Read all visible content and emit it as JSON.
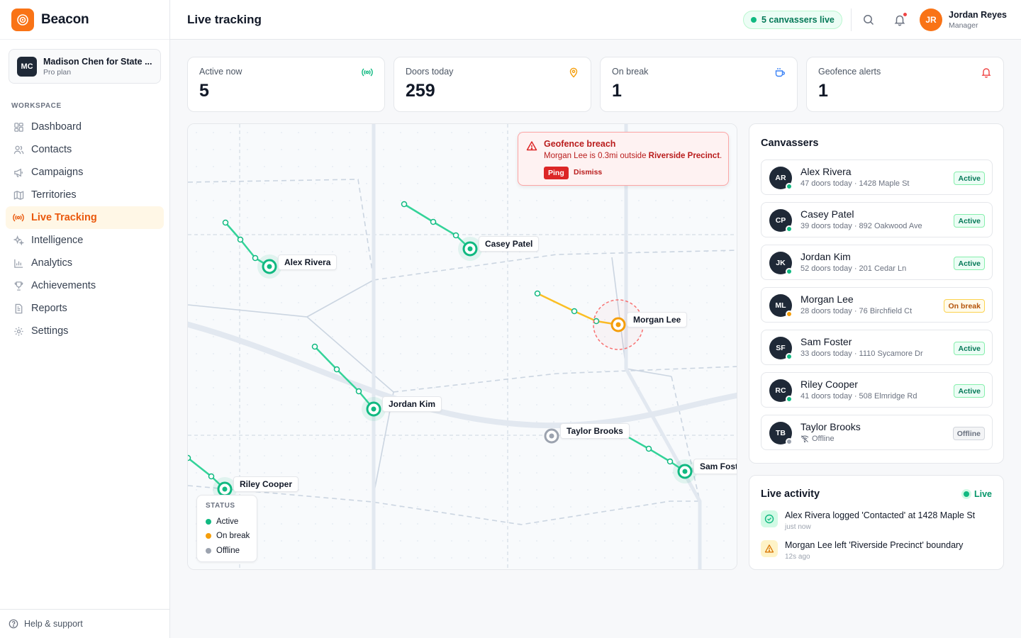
{
  "brand": {
    "name": "Beacon"
  },
  "org": {
    "initials": "MC",
    "name": "Madison Chen for State ...",
    "plan": "Pro plan"
  },
  "sidebar": {
    "section_label": "WORKSPACE",
    "items": [
      {
        "label": "Dashboard",
        "icon": "grid-icon"
      },
      {
        "label": "Contacts",
        "icon": "users-icon"
      },
      {
        "label": "Campaigns",
        "icon": "megaphone-icon"
      },
      {
        "label": "Territories",
        "icon": "map-icon"
      },
      {
        "label": "Live Tracking",
        "icon": "broadcast-icon",
        "active": true
      },
      {
        "label": "Intelligence",
        "icon": "sparkles-icon"
      },
      {
        "label": "Analytics",
        "icon": "bar-chart-icon"
      },
      {
        "label": "Achievements",
        "icon": "trophy-icon"
      },
      {
        "label": "Reports",
        "icon": "file-icon"
      },
      {
        "label": "Settings",
        "icon": "gear-icon"
      }
    ],
    "footer": "Help & support"
  },
  "header": {
    "title": "Live tracking",
    "live_pill": "5 canvassers live",
    "user": {
      "initials": "JR",
      "name": "Jordan Reyes",
      "role": "Manager"
    }
  },
  "stats": [
    {
      "label": "Active now",
      "value": "5",
      "icon": "broadcast-icon",
      "color": "#10b981"
    },
    {
      "label": "Doors today",
      "value": "259",
      "icon": "map-pin-icon",
      "color": "#f59e0b"
    },
    {
      "label": "On break",
      "value": "1",
      "icon": "coffee-icon",
      "color": "#3b82f6"
    },
    {
      "label": "Geofence alerts",
      "value": "1",
      "icon": "bell-icon",
      "color": "#ef4444"
    }
  ],
  "map": {
    "alert": {
      "title": "Geofence breach",
      "body_prefix": "Morgan Lee is 0.3mi outside ",
      "body_place": "Riverside Precinct",
      "body_suffix": ".",
      "ping": "Ping",
      "dismiss": "Dismiss"
    },
    "pins": [
      {
        "name": "Alex Rivera",
        "status": "active"
      },
      {
        "name": "Casey Patel",
        "status": "active"
      },
      {
        "name": "Morgan Lee",
        "status": "break"
      },
      {
        "name": "Jordan Kim",
        "status": "active"
      },
      {
        "name": "Taylor Brooks",
        "status": "offline"
      },
      {
        "name": "Sam Foster",
        "status": "active"
      },
      {
        "name": "Riley Cooper",
        "status": "active"
      }
    ],
    "legend": {
      "title": "STATUS",
      "items": [
        {
          "label": "Active",
          "color": "#10b981"
        },
        {
          "label": "On break",
          "color": "#f59e0b"
        },
        {
          "label": "Offline",
          "color": "#9ca3af"
        }
      ]
    }
  },
  "canvassers": {
    "title": "Canvassers",
    "rows": [
      {
        "initials": "AR",
        "name": "Alex Rivera",
        "meta": "47 doors today · 1428 Maple St",
        "status": "Active"
      },
      {
        "initials": "CP",
        "name": "Casey Patel",
        "meta": "39 doors today · 892 Oakwood Ave",
        "status": "Active"
      },
      {
        "initials": "JK",
        "name": "Jordan Kim",
        "meta": "52 doors today · 201 Cedar Ln",
        "status": "Active"
      },
      {
        "initials": "ML",
        "name": "Morgan Lee",
        "meta": "28 doors today · 76 Birchfield Ct",
        "status": "On break"
      },
      {
        "initials": "SF",
        "name": "Sam Foster",
        "meta": "33 doors today · 1110 Sycamore Dr",
        "status": "Active"
      },
      {
        "initials": "RC",
        "name": "Riley Cooper",
        "meta": "41 doors today · 508 Elmridge Rd",
        "status": "Active"
      },
      {
        "initials": "TB",
        "name": "Taylor Brooks",
        "meta": "Offline",
        "status": "Offline"
      }
    ]
  },
  "activity": {
    "title": "Live activity",
    "live_label": "Live",
    "items": [
      {
        "text": "Alex Rivera logged 'Contacted' at 1428 Maple St",
        "time": "just now",
        "type": "success"
      },
      {
        "text": "Morgan Lee left 'Riverside Precinct' boundary",
        "time": "12s ago",
        "type": "warning"
      }
    ]
  },
  "colors": {
    "accent": "#f97316",
    "active": "#10b981",
    "break": "#f59e0b",
    "offline": "#9ca3af",
    "danger": "#dc2626"
  }
}
